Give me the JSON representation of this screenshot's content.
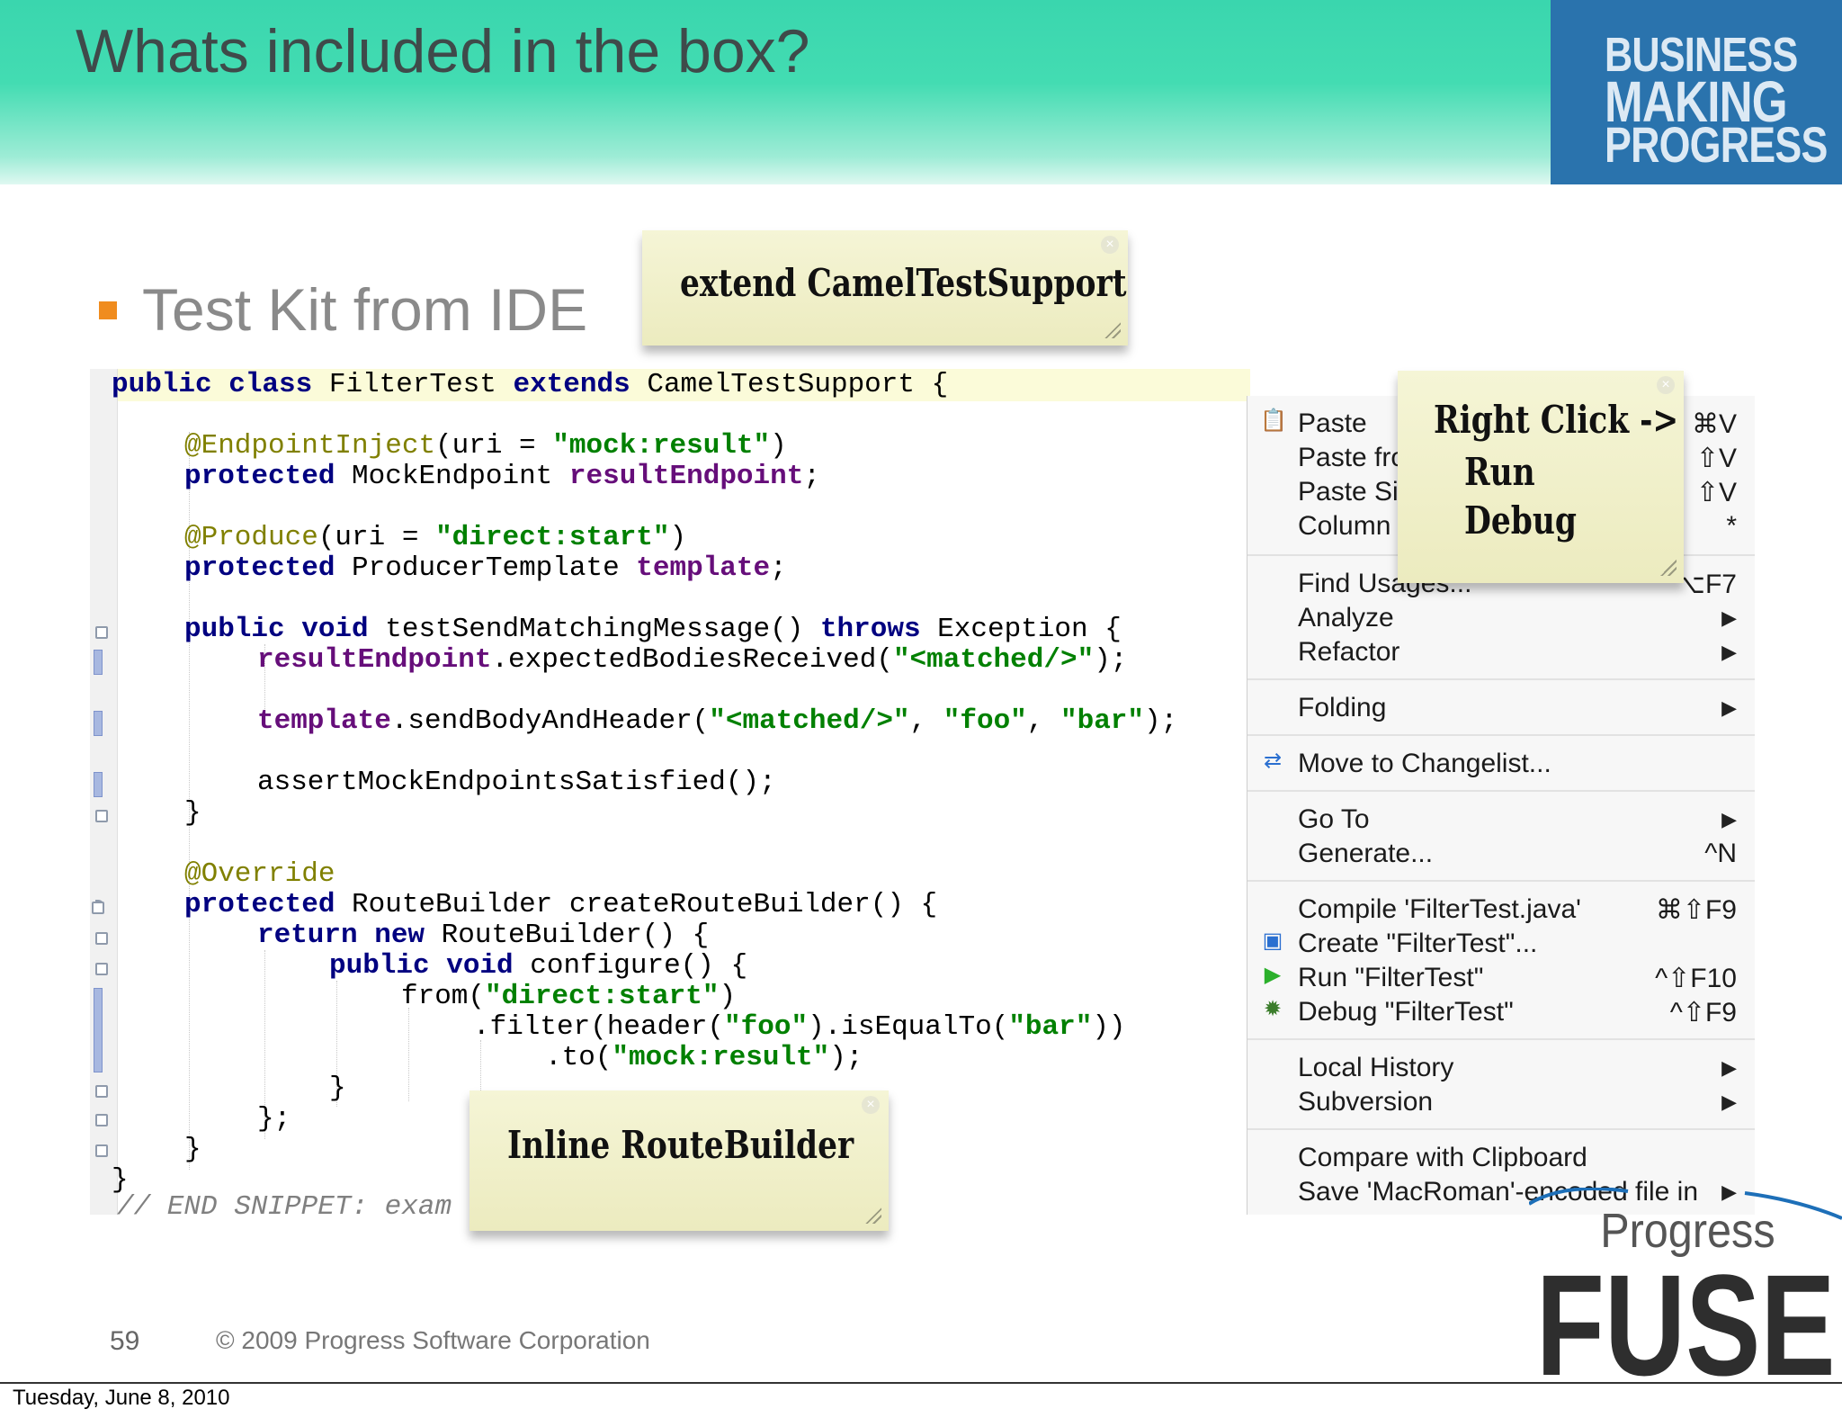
{
  "slide": {
    "title": "Whats included in the box?",
    "brand_lines": [
      "BUSINESS",
      "MAKING",
      "PROGRESS"
    ],
    "bullet": "Test Kit from IDE",
    "page_number": "59",
    "copyright": "© 2009 Progress Software Corporation",
    "date": "Tuesday, June 8, 2010",
    "logo_text": [
      "Progress",
      "FUSE"
    ]
  },
  "notes": {
    "extend": "extend CamelTestSupport",
    "right_click": [
      "Right Click ->",
      "Run",
      "Debug"
    ],
    "inline": "Inline RouteBuilder",
    "close_glyph": "×"
  },
  "code": {
    "class_line": [
      "public class",
      " FilterTest ",
      "extends",
      " CamelTestSupport {"
    ],
    "l2": [
      "@EndpointInject",
      "(uri = ",
      "\"mock:result\"",
      ")"
    ],
    "l3": [
      "protected",
      " MockEndpoint ",
      "resultEndpoint",
      ";"
    ],
    "l4": [
      "@Produce",
      "(uri = ",
      "\"direct:start\"",
      ")"
    ],
    "l5": [
      "protected",
      " ProducerTemplate ",
      "template",
      ";"
    ],
    "l6": [
      "public void",
      " testSendMatchingMessage() ",
      "throws",
      " Exception {"
    ],
    "l7": [
      "resultEndpoint",
      ".expectedBodiesReceived(",
      "\"<matched/>\"",
      ");"
    ],
    "l8": [
      "template",
      ".sendBodyAndHeader(",
      "\"<matched/>\"",
      ", ",
      "\"foo\"",
      ", ",
      "\"bar\"",
      ");"
    ],
    "l9": "assertMockEndpointsSatisfied();",
    "l10": "}",
    "l11": "@Override",
    "l12": [
      "protected",
      " RouteBuilder createRouteBuilder() {"
    ],
    "l13": [
      "return new",
      " RouteBuilder() {"
    ],
    "l14": [
      "public void",
      " configure() {"
    ],
    "l15": [
      "from(",
      "\"direct:start\"",
      ")"
    ],
    "l16": [
      ".filter(header(",
      "\"foo\"",
      ").isEqualTo(",
      "\"bar\"",
      "))"
    ],
    "l17": [
      ".to(",
      "\"mock:result\"",
      ");"
    ],
    "l18": "}",
    "l19": "};",
    "l20": "}",
    "l21": "}",
    "l22": "// END SNIPPET: exam"
  },
  "menu": {
    "items": [
      {
        "label": "Paste",
        "shortcut": "⌘V",
        "icon": "clipboard-icon"
      },
      {
        "label": "Paste fro",
        "shortcut": "⇧V"
      },
      {
        "label": "Paste Si",
        "shortcut": "⇧V"
      },
      {
        "label": "Column",
        "shortcut": "*"
      },
      {
        "label": "Find Usages...",
        "shortcut": "⌥F7"
      },
      {
        "label": "Analyze",
        "submenu": true
      },
      {
        "label": "Refactor",
        "submenu": true
      },
      {
        "label": "Folding",
        "submenu": true
      },
      {
        "label": "Move to Changelist...",
        "icon": "changelist-icon"
      },
      {
        "label": "Go To",
        "submenu": true
      },
      {
        "label": "Generate...",
        "shortcut": "^N"
      },
      {
        "label": "Compile 'FilterTest.java'",
        "shortcut": "⌘⇧F9"
      },
      {
        "label": "Create \"FilterTest\"...",
        "icon": "run-config-icon"
      },
      {
        "label": "Run \"FilterTest\"",
        "shortcut": "^⇧F10",
        "icon": "run-icon"
      },
      {
        "label": "Debug \"FilterTest\"",
        "shortcut": "^⇧F9",
        "icon": "debug-icon"
      },
      {
        "label": "Local History",
        "submenu": true
      },
      {
        "label": "Subversion",
        "submenu": true
      },
      {
        "label": "Compare with Clipboard"
      },
      {
        "label": "Save 'MacRoman'-encoded file in",
        "submenu": true
      }
    ],
    "submenu_glyph": "▶"
  },
  "colors": {
    "header_green": "#3ad6ae",
    "brand_blue": "#2a73ad",
    "bullet_orange": "#f08c1e",
    "note_yellow": "#f2f1cd",
    "keyword": "#000080",
    "annotation": "#808000",
    "string": "#008000",
    "field": "#660e7a"
  }
}
